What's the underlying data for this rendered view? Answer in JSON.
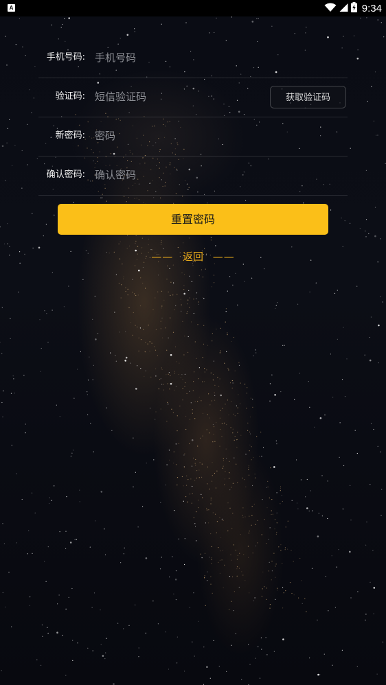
{
  "status_bar": {
    "notification_letter": "A",
    "time": "9:34",
    "icons": [
      "wifi-icon",
      "signal-icon",
      "battery-charging-icon"
    ]
  },
  "form": {
    "phone": {
      "label": "手机号码:",
      "placeholder": "手机号码",
      "value": ""
    },
    "code": {
      "label": "验证码:",
      "placeholder": "短信验证码",
      "value": "",
      "button_label": "获取验证码"
    },
    "new_password": {
      "label": "新密码:",
      "placeholder": "密码",
      "value": ""
    },
    "confirm_password": {
      "label": "确认密码:",
      "placeholder": "确认密码",
      "value": ""
    }
  },
  "actions": {
    "reset_label": "重置密码",
    "back_dash_left": "——",
    "back_label": "返回",
    "back_dash_right": "——"
  },
  "colors": {
    "accent": "#fbbf18",
    "back_link": "#e8a91a",
    "background": "#0a0c14"
  }
}
